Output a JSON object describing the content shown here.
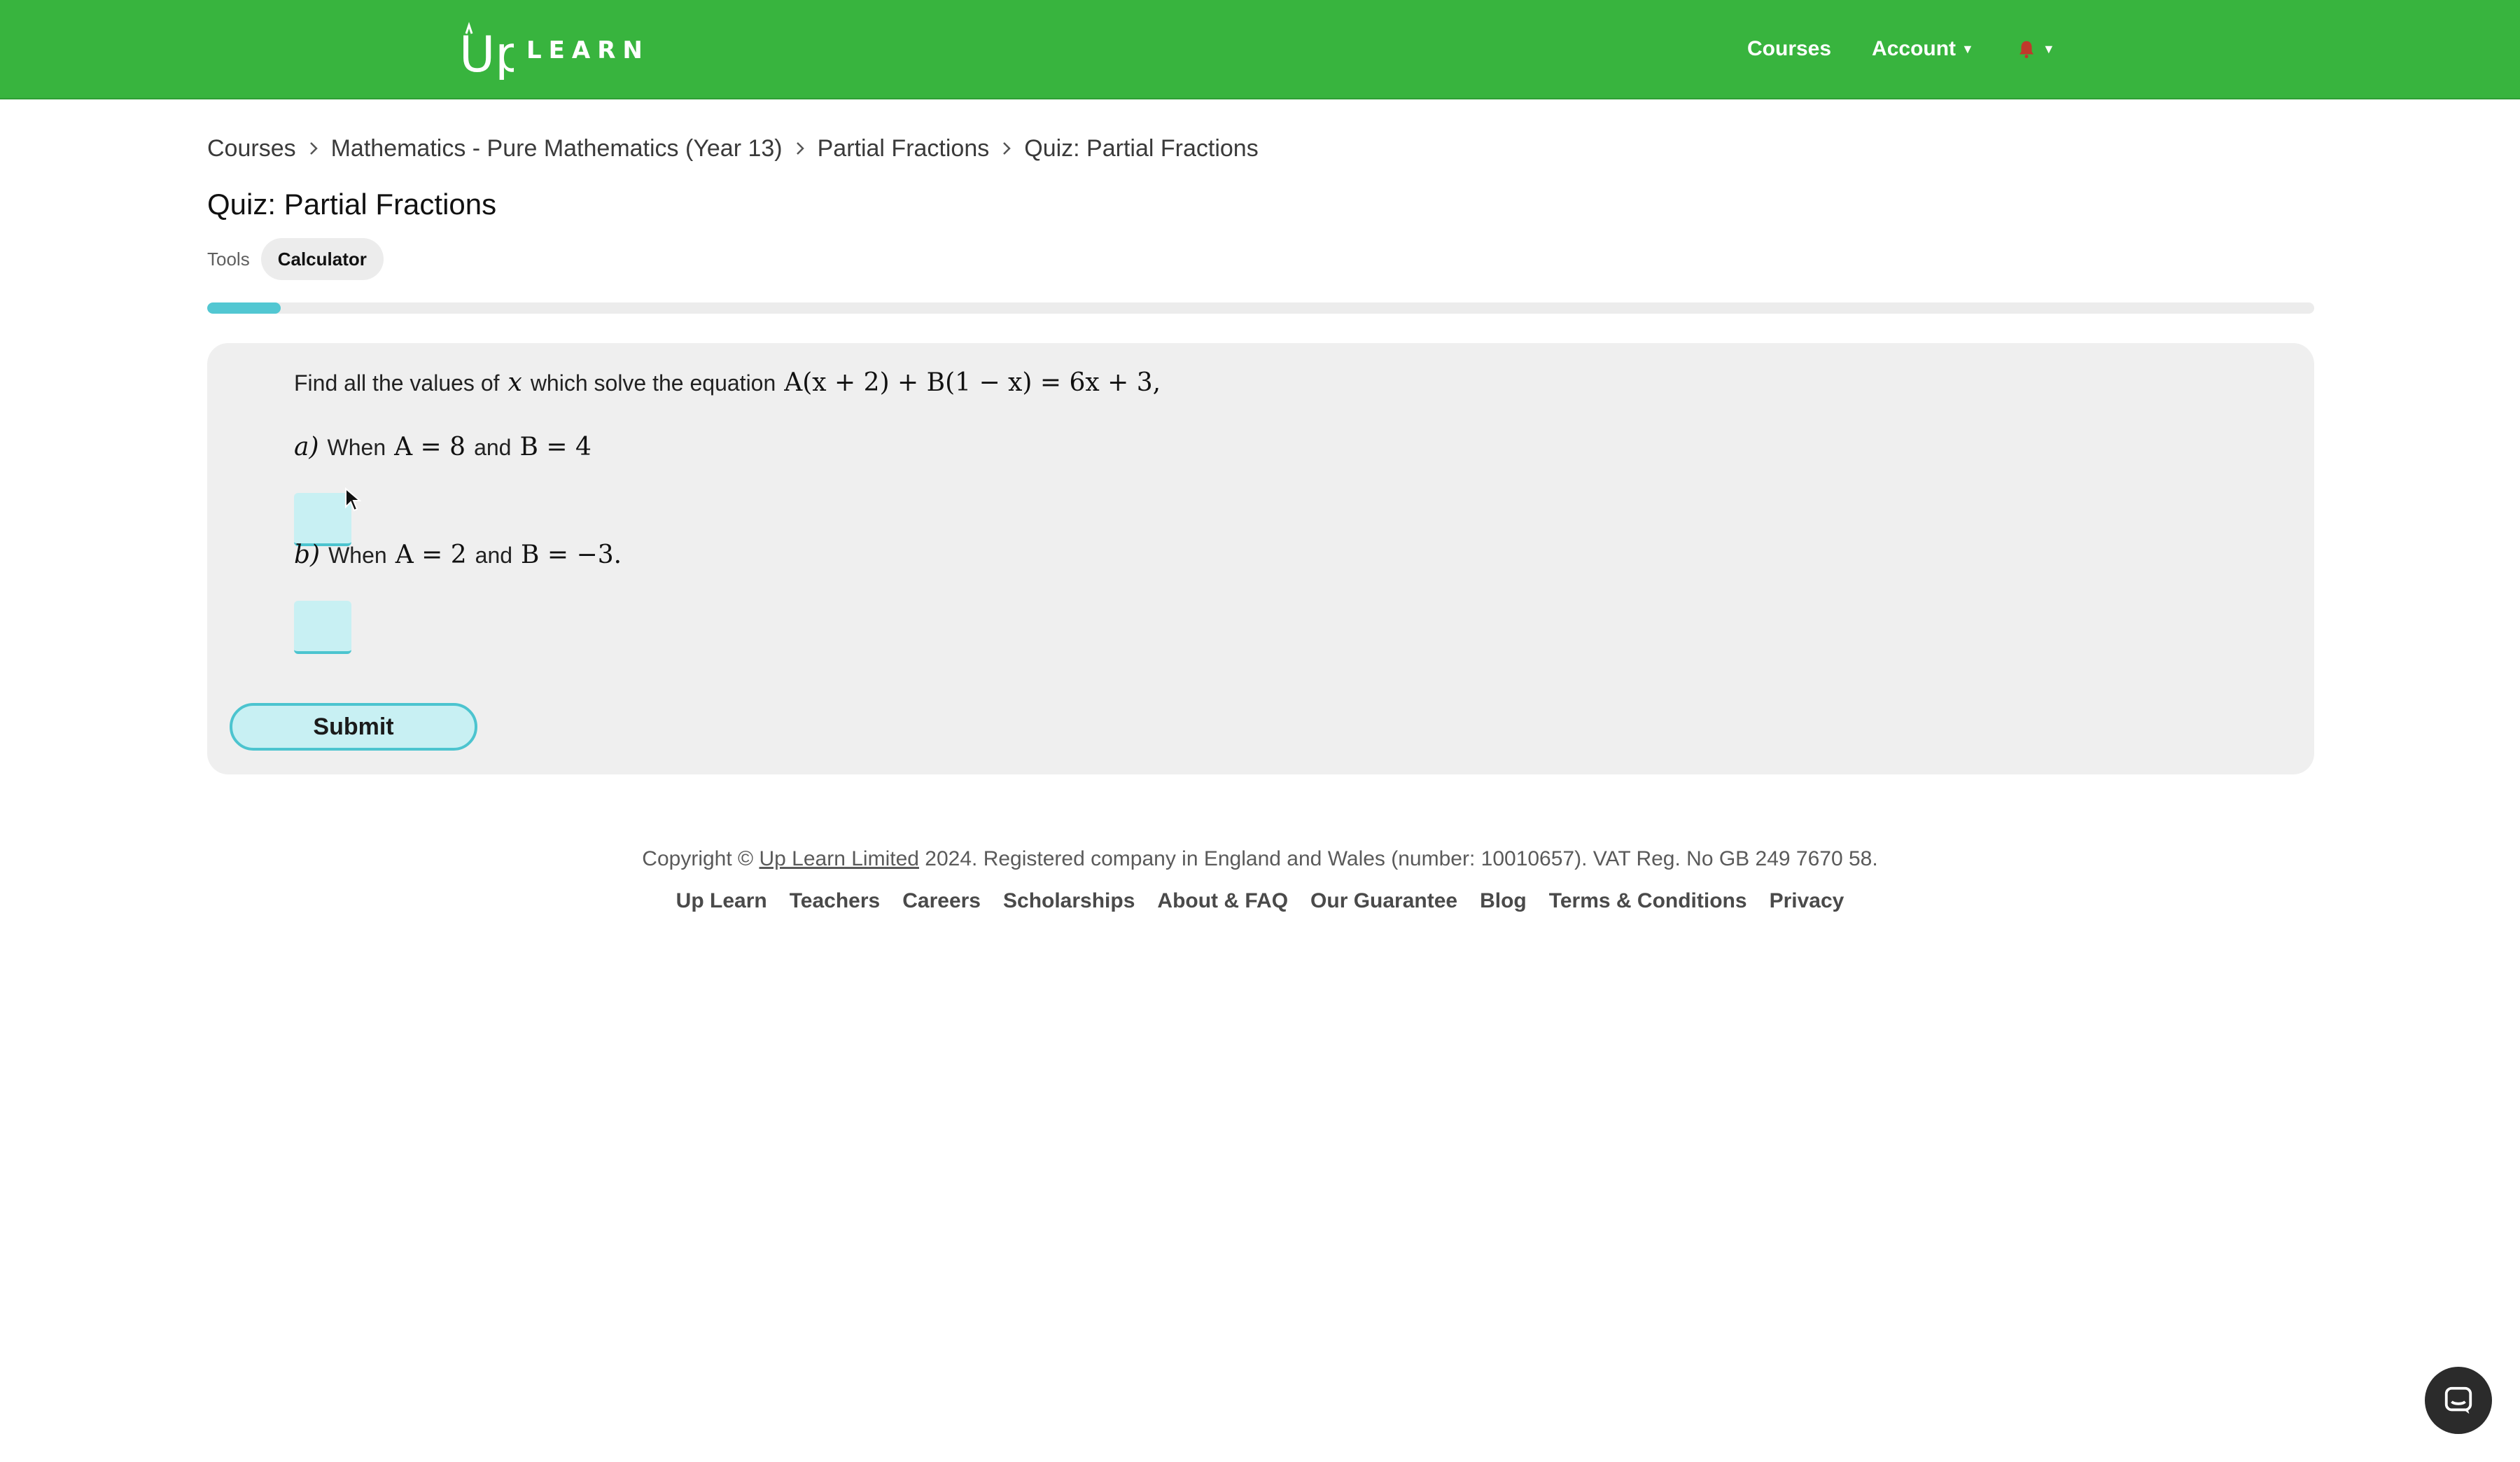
{
  "brand": {
    "logo_text": "LEARN",
    "logo_mark": "Up",
    "green": "#38b43e",
    "accent": "#52c7d2"
  },
  "nav": {
    "courses": "Courses",
    "account": "Account",
    "notifications_icon": "bell-icon"
  },
  "breadcrumb": [
    "Courses",
    "Mathematics - Pure Mathematics (Year 13)",
    "Partial Fractions",
    "Quiz: Partial Fractions"
  ],
  "page": {
    "title": "Quiz: Partial Fractions",
    "tools_label": "Tools",
    "calculator_label": "Calculator",
    "progress_fraction": 0.035
  },
  "quiz": {
    "prompt_text": "Find all the values of",
    "prompt_var": "x",
    "prompt_text2": "which solve the equation",
    "prompt_equation": "A(x + 2) + B(1 − x) = 6x + 3,",
    "part_a": {
      "label": "a)",
      "when": "When",
      "cond1": "A = 8",
      "and": "and",
      "cond2": "B = 4"
    },
    "part_b": {
      "label": "b)",
      "when": "When",
      "cond1": "A = 2",
      "and": "and",
      "cond2": "B = −3."
    },
    "submit": "Submit"
  },
  "footer": {
    "copyright_pre": "Copyright ©",
    "company": "Up Learn Limited",
    "copyright_post": "2024. Registered company in England and Wales (number: 10010657). VAT Reg. No GB 249 7670 58.",
    "links": [
      "Up Learn",
      "Teachers",
      "Careers",
      "Scholarships",
      "About & FAQ",
      "Our Guarantee",
      "Blog",
      "Terms & Conditions",
      "Privacy"
    ]
  }
}
